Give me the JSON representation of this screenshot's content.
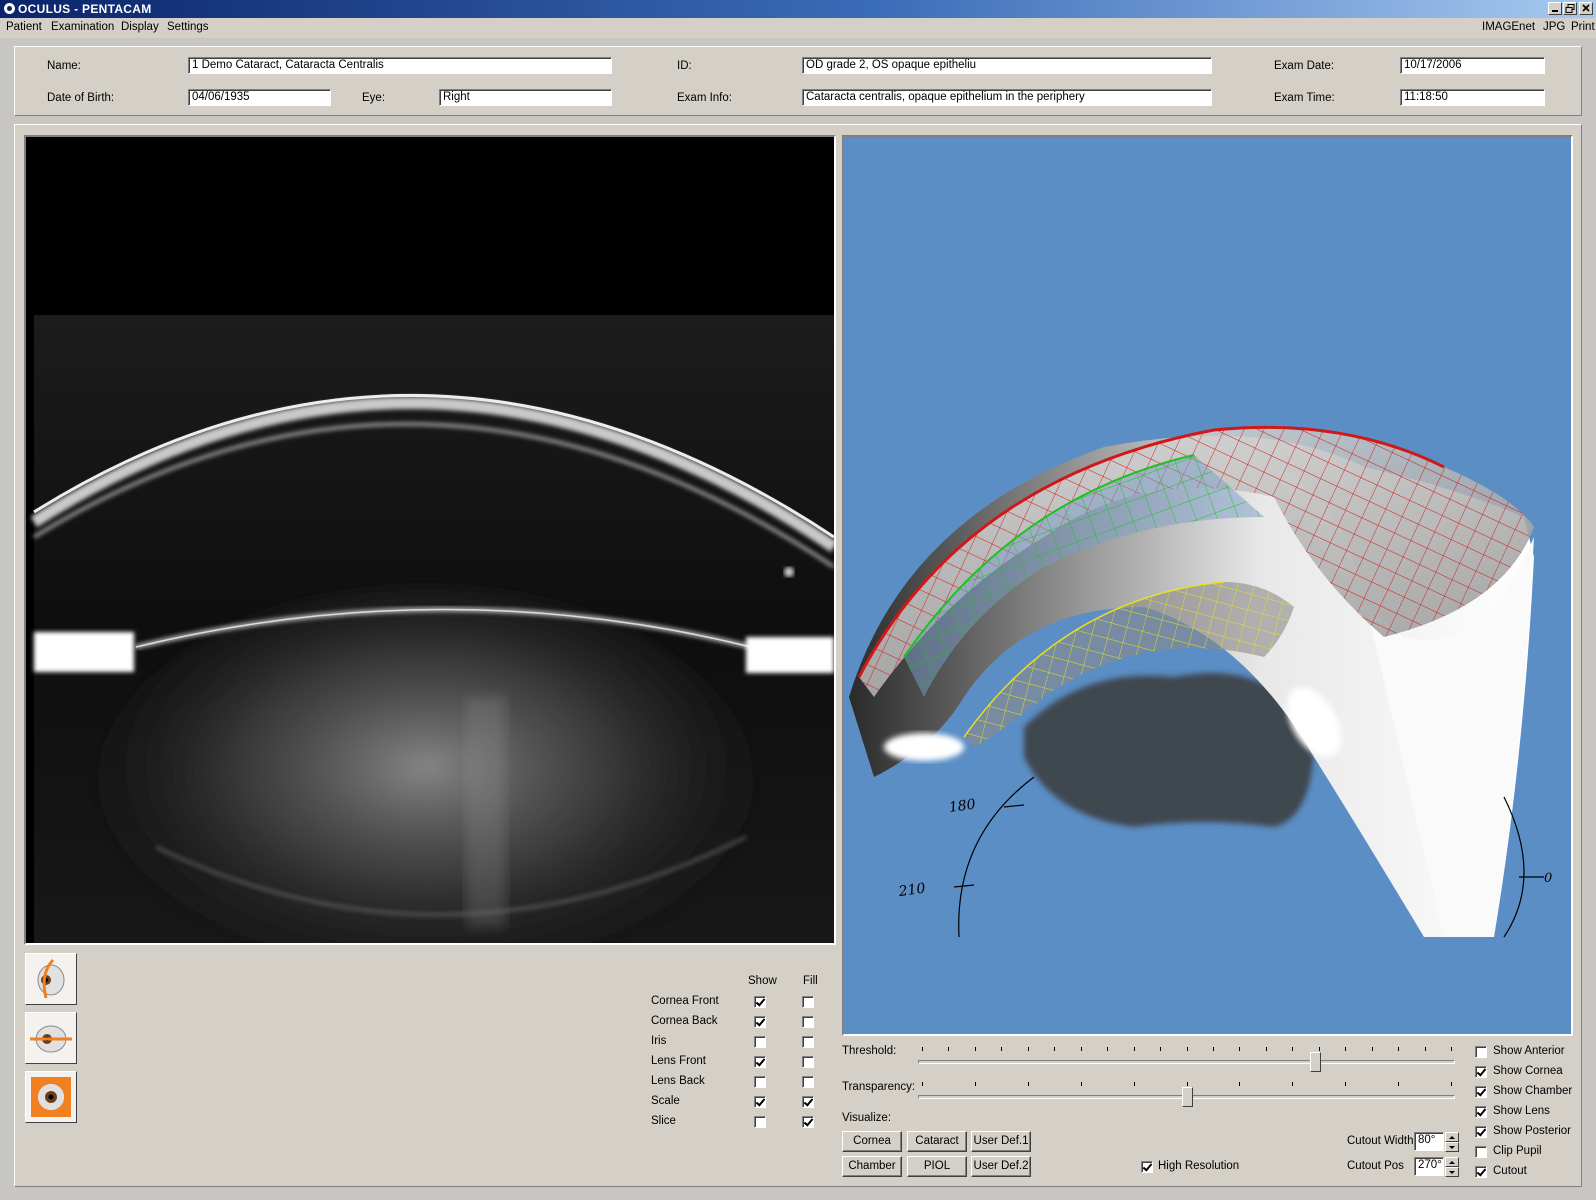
{
  "window": {
    "title": "OCULUS  -  PENTACAM"
  },
  "menu": {
    "left": [
      "Patient",
      "Examination",
      "Display",
      "Settings"
    ],
    "right": [
      "IMAGEnet",
      "JPG",
      "Print"
    ]
  },
  "patient": {
    "name_label": "Name:",
    "name": "1 Demo Cataract, Cataracta Centralis",
    "dob_label": "Date of Birth:",
    "dob": "04/06/1935",
    "eye_label": "Eye:",
    "eye": "Right",
    "id_label": "ID:",
    "id": "OD grade 2, OS opaque epitheliu",
    "info_label": "Exam Info:",
    "info": "Cataracta centralis, opaque epithelium in the periphery",
    "date_label": "Exam Date:",
    "date": "10/17/2006",
    "time_label": "Exam Time:",
    "time": "11:18:50"
  },
  "layers": {
    "show_header": "Show",
    "fill_header": "Fill",
    "rows": [
      {
        "label": "Cornea Front",
        "show": true,
        "fill": false
      },
      {
        "label": "Cornea Back",
        "show": true,
        "fill": false
      },
      {
        "label": "Iris",
        "show": false,
        "fill": false
      },
      {
        "label": "Lens Front",
        "show": true,
        "fill": false
      },
      {
        "label": "Lens Back",
        "show": false,
        "fill": false
      },
      {
        "label": "Scale",
        "show": true,
        "fill": true
      },
      {
        "label": "Slice",
        "show": false,
        "fill": true
      }
    ]
  },
  "controls": {
    "threshold_label": "Threshold:",
    "threshold_value": 0.74,
    "transparency_label": "Transparency:",
    "transparency_value": 0.5,
    "visualize_label": "Visualize:",
    "buttons_row1": [
      "Cornea",
      "Cataract",
      "User Def.1"
    ],
    "buttons_row2": [
      "Chamber",
      "PIOL",
      "User Def.2"
    ],
    "high_resolution_label": "High Resolution",
    "high_resolution": true,
    "cutout_width_label": "Cutout Width",
    "cutout_width": "80°",
    "cutout_pos_label": "Cutout Pos",
    "cutout_pos": "270°"
  },
  "options": [
    {
      "label": "Show Anterior",
      "checked": false
    },
    {
      "label": "Show Cornea",
      "checked": true
    },
    {
      "label": "Show Chamber",
      "checked": true
    },
    {
      "label": "Show Lens",
      "checked": true
    },
    {
      "label": "Show Posterior",
      "checked": true
    },
    {
      "label": "Clip Pupil",
      "checked": false
    },
    {
      "label": "Cutout",
      "checked": true
    }
  ],
  "scale_labels": [
    "180",
    "210",
    "0"
  ],
  "colors": {
    "view3d_bg": "#5b8ec5",
    "titlebar": "#0a246a",
    "cornea_front": "#d01818",
    "cornea_back": "#20c020",
    "lens_front": "#e8e020"
  }
}
